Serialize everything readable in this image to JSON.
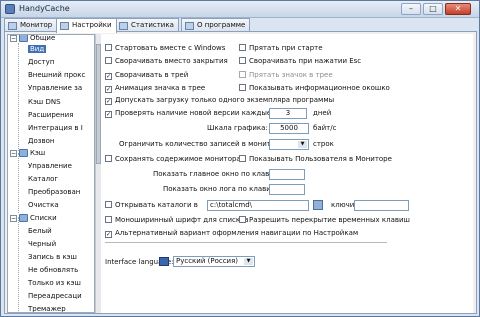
{
  "window": {
    "title": "HandyCache"
  },
  "tabs": [
    "Монитор",
    "Настройки",
    "Статистика",
    "О программе"
  ],
  "tree": {
    "groups": [
      {
        "label": "Общие",
        "children": [
          "Вид",
          "Доступ",
          "Внешний прокс",
          "Управление за",
          "Кэш DNS",
          "Расширения",
          "Интеграция в I",
          "Дозвон"
        ]
      },
      {
        "label": "Кэш",
        "children": [
          "Управление",
          "Каталог",
          "Преобразован",
          "Очистка"
        ]
      },
      {
        "label": "Списки",
        "children": [
          "Белый",
          "Черный",
          "Запись в кэш",
          "Не обновлять",
          "Только из кэш",
          "Переадресаци",
          "Тремажер"
        ]
      }
    ]
  },
  "options": {
    "start_with_windows": "Стартовать вместе с Windows",
    "hide_on_start": "Прятать при старте",
    "minimize_on_close": "Сворачивать вместо закрытия",
    "minimize_on_esc": "Сворачивать при нажатии Esc",
    "minimize_to_tray": "Сворачивать в трей",
    "hide_tray_icon": "Прятать значок в трее",
    "tray_animation": "Анимация значка в трее",
    "show_info_window": "Показывать информационное окошко",
    "single_instance": "Допускать загрузку только одного экземпляра программы",
    "check_new_version": "Проверять наличие новой версии каждые",
    "save_monitor": "Сохранять содержимое монитора",
    "show_user": "Показывать Пользователя в Мониторе",
    "open_catalogs": "Открывать каталоги в",
    "mono_font": "Моноширинный шрифт для списков",
    "allow_overlap": "Разрешить перекрытие временных клавиш",
    "alt_nav": "Альтернативный вариант оформления навигации по Настройкам"
  },
  "fields": {
    "days_value": "3",
    "days_unit": "дней",
    "graph_scale_label": "Шкала графика:",
    "graph_scale_value": "5000",
    "graph_scale_unit": "байт/с",
    "limit_label": "Ограничить  количество  записей в мониторе",
    "limit_unit": "строк",
    "main_window_label": "Показать главное окно по клавише:",
    "log_window_label": "Показать окно лога по клавише:",
    "catalog_path": "c:\\totalcmd\\",
    "keys_label": "ключи:",
    "interface_label": "Interface language:",
    "language": "Русский (Россия)"
  }
}
